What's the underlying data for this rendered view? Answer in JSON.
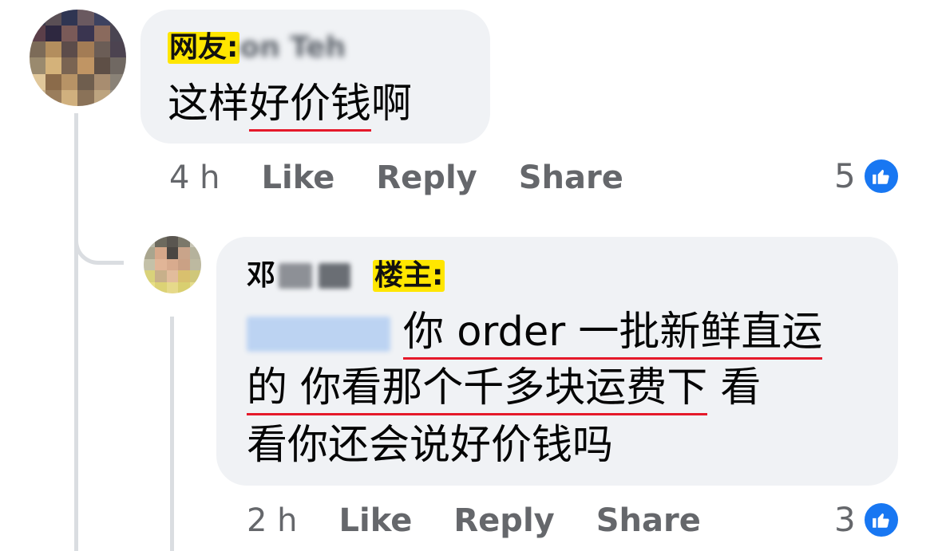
{
  "colors": {
    "bubble": "#f0f2f5",
    "meta_text": "#65676b",
    "like_blue": "#1877f2",
    "tag_yellow": "#ffe600",
    "underline_red": "#e5192a"
  },
  "comments": [
    {
      "tag": "网友:",
      "name_blurred": "on Teh",
      "text_parts": [
        "这样",
        "好价钱",
        "啊"
      ],
      "time": "4 h",
      "actions": {
        "like": "Like",
        "reply": "Reply",
        "share": "Share"
      },
      "reaction_count": "5",
      "reaction_icon": "like-icon"
    },
    {
      "surname": "邓",
      "tag": "楼主:",
      "line1_text": "你 order 一批新鲜直运",
      "line2_underlined": "的 你看那个千多块运费下",
      "line2_rest": " 看",
      "line3": "看你还会说好价钱吗",
      "time": "2 h",
      "actions": {
        "like": "Like",
        "reply": "Reply",
        "share": "Share"
      },
      "reaction_count": "3",
      "reaction_icon": "like-icon"
    }
  ]
}
